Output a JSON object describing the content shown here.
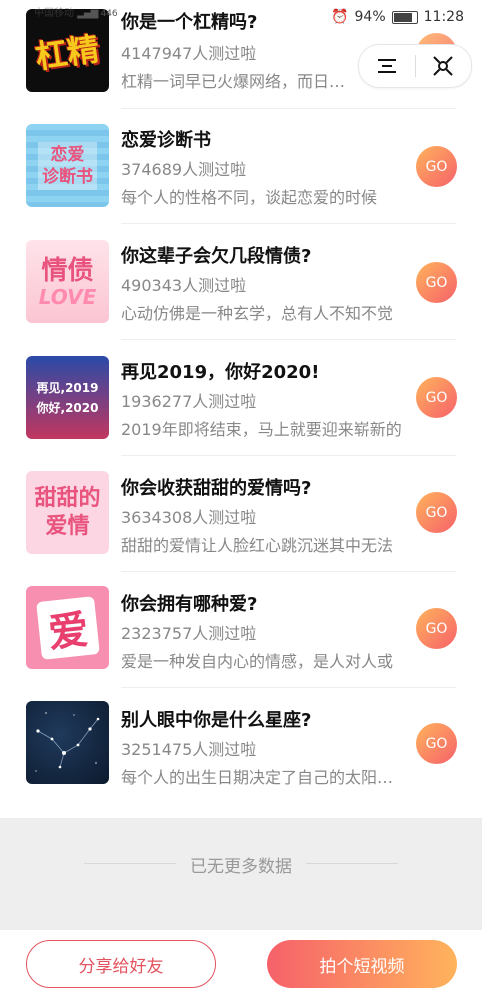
{
  "status_bar": {
    "carrier": "中国移动",
    "speed": "446",
    "battery": "94%",
    "time": "11:28"
  },
  "items": [
    {
      "title": "你是一个杠精吗?",
      "count": "4147947人测过啦",
      "desc": "杠精一词早已火爆网络，而日常生活中",
      "thumb_text": "杠精",
      "go": "GO"
    },
    {
      "title": "恋爱诊断书",
      "count": "374689人测过啦",
      "desc": "每个人的性格不同，谈起恋爱的时候",
      "thumb_text": "恋爱\n诊断书",
      "go": "GO"
    },
    {
      "title": "你这辈子会欠几段情债?",
      "count": "490343人测过啦",
      "desc": "心动仿佛是一种玄学，总有人不知不觉",
      "thumb_text": "情债",
      "thumb_sub": "LOVE",
      "go": "GO"
    },
    {
      "title": "再见2019，你好2020!",
      "count": "1936277人测过啦",
      "desc": "2019年即将结束，马上就要迎来崭新的",
      "thumb_text": "再见,2019\n你好,2020",
      "go": "GO"
    },
    {
      "title": "你会收获甜甜的爱情吗?",
      "count": "3634308人测过啦",
      "desc": "甜甜的爱情让人脸红心跳沉迷其中无法",
      "thumb_text": "甜甜的\n爱情",
      "go": "GO"
    },
    {
      "title": "你会拥有哪种爱?",
      "count": "2323757人测过啦",
      "desc": "爱是一种发自内心的情感，是人对人或",
      "thumb_text": "爱",
      "go": "GO"
    },
    {
      "title": "别人眼中你是什么星座?",
      "count": "3251475人测过啦",
      "desc": "每个人的出生日期决定了自己的太阳星座",
      "thumb_text": "",
      "go": "GO"
    }
  ],
  "no_more": "已无更多数据",
  "buttons": {
    "share": "分享给好友",
    "video": "拍个短视频"
  }
}
